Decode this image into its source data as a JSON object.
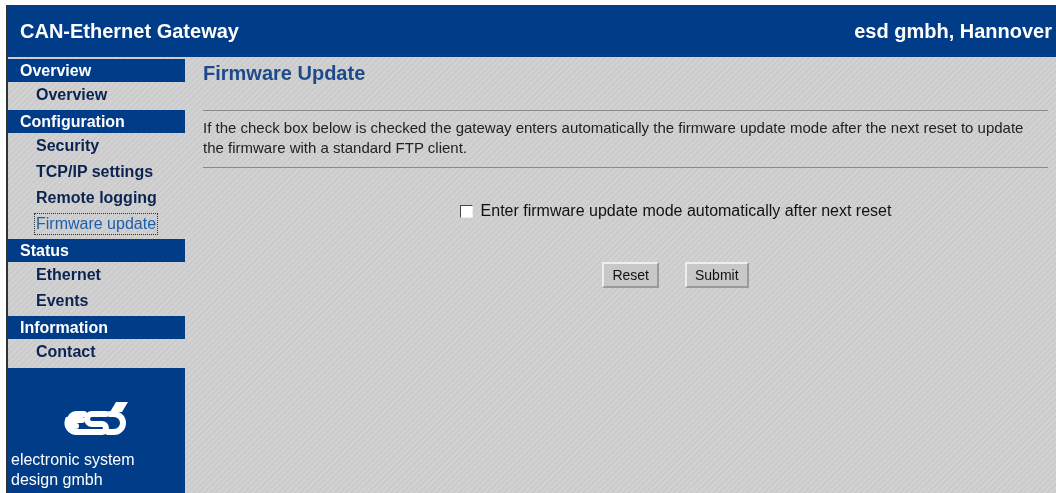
{
  "header": {
    "title": "CAN-Ethernet Gateway",
    "company": "esd gmbh, Hannover"
  },
  "sidebar": {
    "groups": [
      {
        "title": "Overview",
        "items": [
          {
            "label": "Overview",
            "selected": false
          }
        ]
      },
      {
        "title": "Configuration",
        "items": [
          {
            "label": "Security",
            "selected": false
          },
          {
            "label": "TCP/IP settings",
            "selected": false
          },
          {
            "label": "Remote logging",
            "selected": false
          },
          {
            "label": "Firmware update",
            "selected": true
          }
        ]
      },
      {
        "title": "Status",
        "items": [
          {
            "label": "Ethernet",
            "selected": false
          },
          {
            "label": "Events",
            "selected": false
          }
        ]
      },
      {
        "title": "Information",
        "items": [
          {
            "label": "Contact",
            "selected": false
          }
        ]
      }
    ],
    "logo_caption": "electronic system design gmbh"
  },
  "page": {
    "heading": "Firmware Update",
    "description": "If the check box below is checked the gateway enters automatically the firmware update mode after the next reset to update the firmware with a standard FTP client.",
    "checkbox": {
      "label": "Enter firmware update mode automatically after next reset",
      "checked": false
    },
    "buttons": [
      "Reset",
      "Submit"
    ]
  }
}
